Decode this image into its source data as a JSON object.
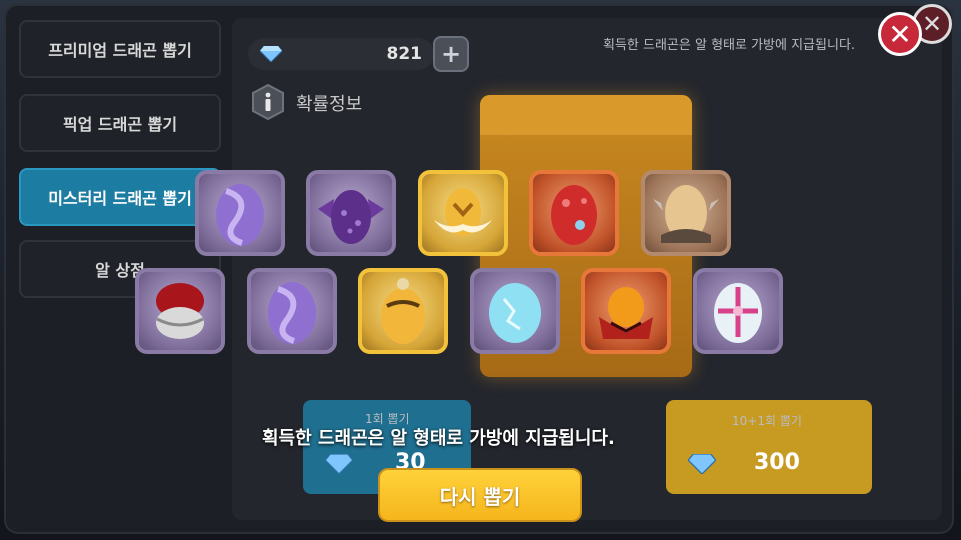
{
  "sidebar": {
    "items": [
      {
        "label": "프리미엄 드래곤 뽑기",
        "active": false
      },
      {
        "label": "픽업 드래곤 뽑기",
        "active": false
      },
      {
        "label": "미스터리 드래곤 뽑기",
        "active": true
      },
      {
        "label": "알 상점",
        "active": false
      }
    ]
  },
  "header": {
    "gem_count": "821",
    "plus_label": "+",
    "notice": "획득한 드래곤은 알 형태로 가방에 지급됩니다.",
    "info_label": "확률정보"
  },
  "draw_options": [
    {
      "label": "1회 뽑기",
      "price": "30"
    },
    {
      "label": "10+1회 뽑기",
      "price": "300"
    }
  ],
  "result": {
    "eggs_row1": [
      {
        "icon": "purple-swirl-egg-icon",
        "frame": "purple"
      },
      {
        "icon": "purple-bat-egg-icon",
        "frame": "purple"
      },
      {
        "icon": "golden-winged-egg-icon",
        "frame": "gold"
      },
      {
        "icon": "red-spotted-egg-icon",
        "frame": "red"
      },
      {
        "icon": "spiked-tan-egg-icon",
        "frame": "brown"
      }
    ],
    "eggs_row2": [
      {
        "icon": "red-wrapped-egg-icon",
        "frame": "purple"
      },
      {
        "icon": "purple-swirl-egg-icon",
        "frame": "purple"
      },
      {
        "icon": "golden-ornate-egg-icon",
        "frame": "gold"
      },
      {
        "icon": "ice-cracked-egg-icon",
        "frame": "purple"
      },
      {
        "icon": "red-crested-egg-icon",
        "frame": "red"
      },
      {
        "icon": "white-cross-egg-icon",
        "frame": "purple"
      }
    ],
    "message": "획득한 드래곤은 알 형태로 가방에 지급됩니다.",
    "retry_label": "다시 뽑기"
  },
  "colors": {
    "accent_blue": "#1d7ca1",
    "gold_button": "#f5b51c",
    "close_red": "#c7283a"
  }
}
